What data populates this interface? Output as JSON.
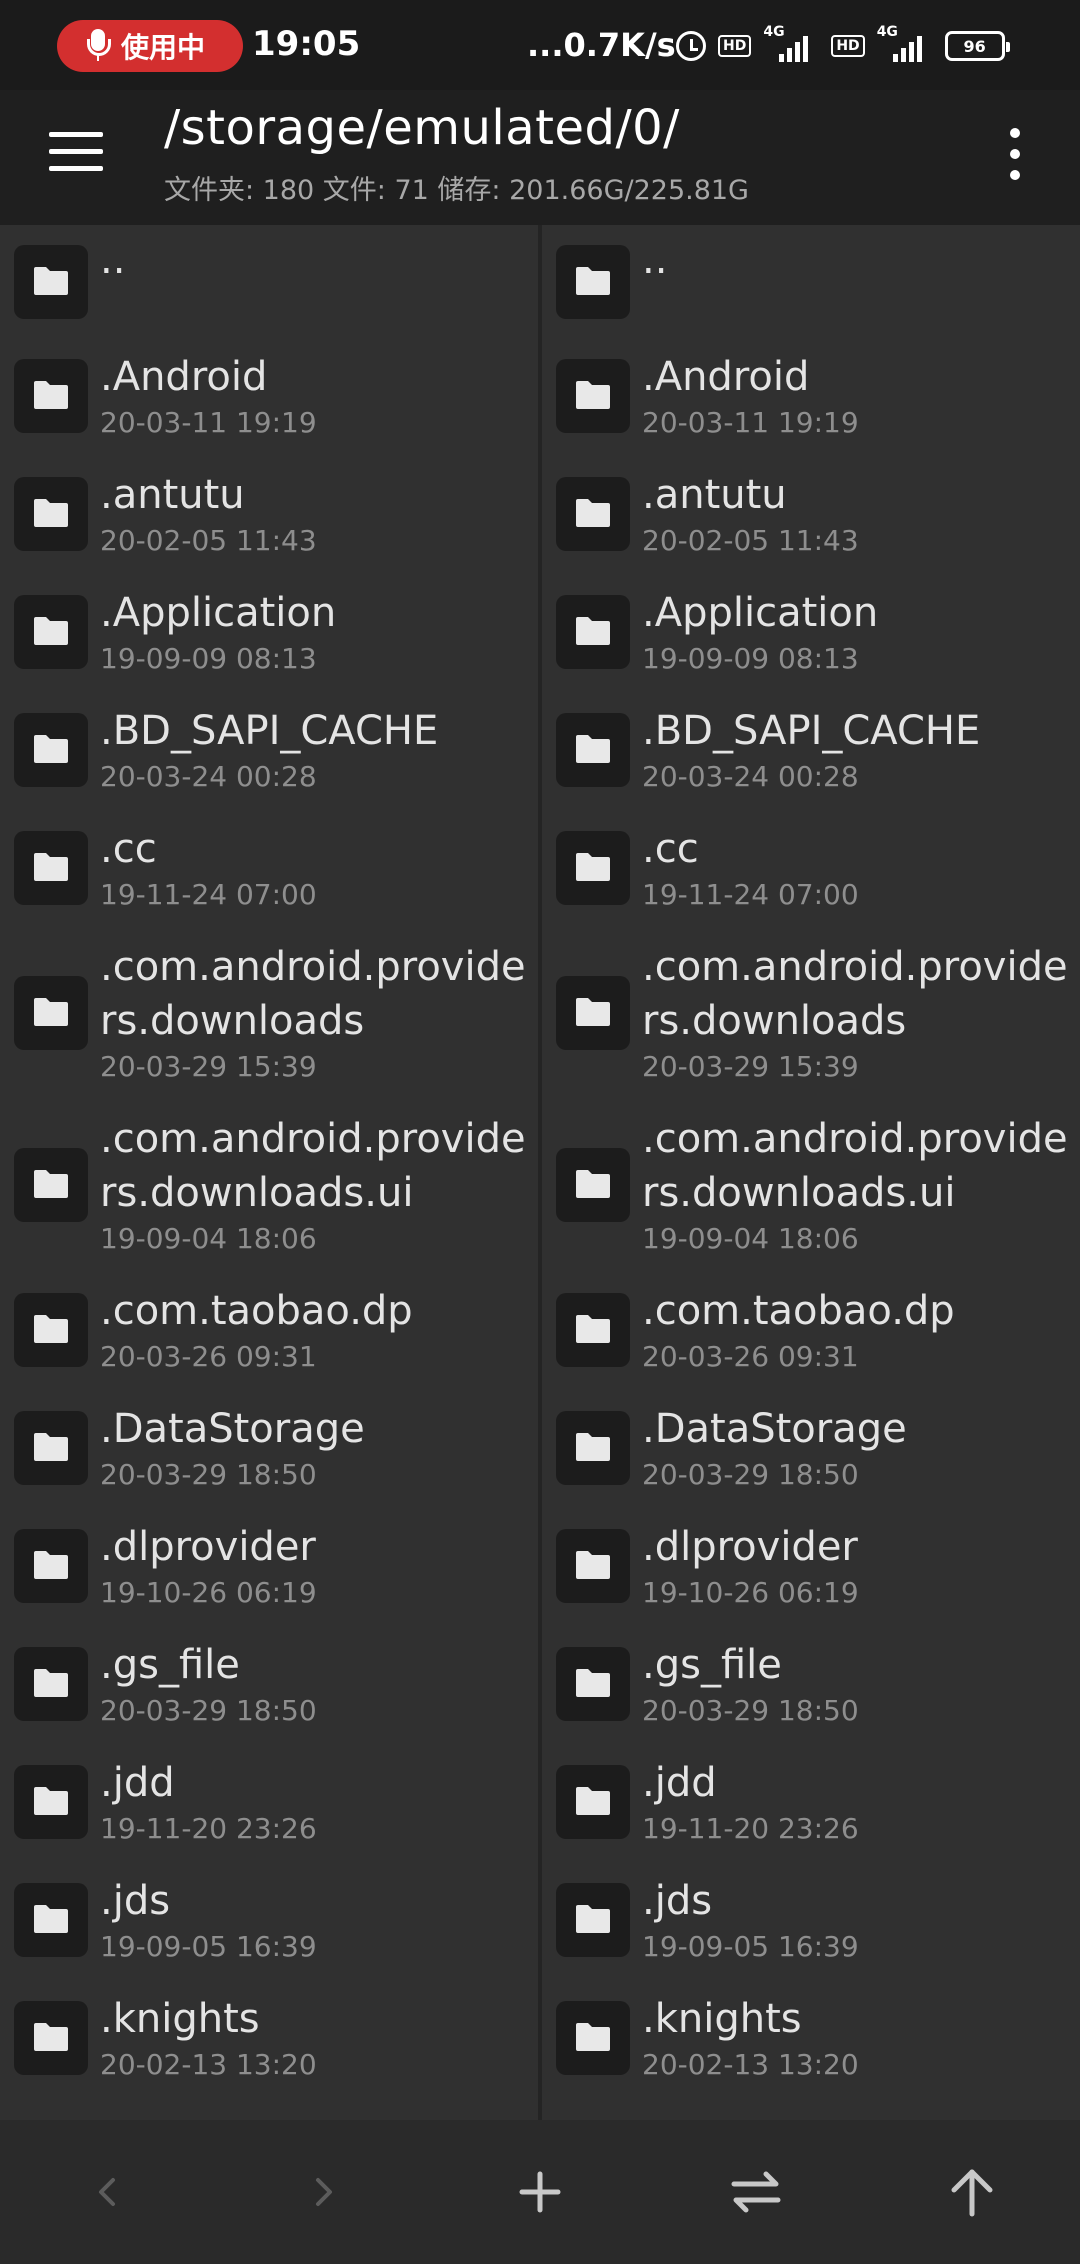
{
  "status_bar": {
    "mic_label": "使用中",
    "time": "19:05",
    "net_speed": "...0.7K/s",
    "hd1": "HD",
    "net1": "4G",
    "hd2": "HD",
    "net2": "4G",
    "battery": "96"
  },
  "toolbar": {
    "path": "/storage/emulated/0/",
    "summary": "文件夹: 180   文件: 71   储存: 201.66G/225.81G"
  },
  "left_pane": {
    "items": [
      {
        "name": "..",
        "date": ""
      },
      {
        "name": ".Android",
        "date": "20-03-11 19:19"
      },
      {
        "name": ".antutu",
        "date": "20-02-05 11:43"
      },
      {
        "name": ".Application",
        "date": "19-09-09 08:13"
      },
      {
        "name": ".BD_SAPI_CACHE",
        "date": "20-03-24 00:28"
      },
      {
        "name": ".cc",
        "date": "19-11-24 07:00"
      },
      {
        "name": ".com.android.providers.downloads",
        "date": "20-03-29 15:39"
      },
      {
        "name": ".com.android.providers.downloads.ui",
        "date": "19-09-04 18:06"
      },
      {
        "name": ".com.taobao.dp",
        "date": "20-03-26 09:31"
      },
      {
        "name": ".DataStorage",
        "date": "20-03-29 18:50"
      },
      {
        "name": ".dlprovider",
        "date": "19-10-26 06:19"
      },
      {
        "name": ".gs_file",
        "date": "20-03-29 18:50"
      },
      {
        "name": ".jdd",
        "date": "19-11-20 23:26"
      },
      {
        "name": ".jds",
        "date": "19-09-05 16:39"
      },
      {
        "name": ".knights",
        "date": "20-02-13 13:20"
      }
    ]
  },
  "right_pane": {
    "items": [
      {
        "name": "..",
        "date": ""
      },
      {
        "name": ".Android",
        "date": "20-03-11 19:19"
      },
      {
        "name": ".antutu",
        "date": "20-02-05 11:43"
      },
      {
        "name": ".Application",
        "date": "19-09-09 08:13"
      },
      {
        "name": ".BD_SAPI_CACHE",
        "date": "20-03-24 00:28"
      },
      {
        "name": ".cc",
        "date": "19-11-24 07:00"
      },
      {
        "name": ".com.android.providers.downloads",
        "date": "20-03-29 15:39"
      },
      {
        "name": ".com.android.providers.downloads.ui",
        "date": "19-09-04 18:06"
      },
      {
        "name": ".com.taobao.dp",
        "date": "20-03-26 09:31"
      },
      {
        "name": ".DataStorage",
        "date": "20-03-29 18:50"
      },
      {
        "name": ".dlprovider",
        "date": "19-10-26 06:19"
      },
      {
        "name": ".gs_file",
        "date": "20-03-29 18:50"
      },
      {
        "name": ".jdd",
        "date": "19-11-20 23:26"
      },
      {
        "name": ".jds",
        "date": "19-09-05 16:39"
      },
      {
        "name": ".knights",
        "date": "20-02-13 13:20"
      }
    ]
  },
  "bottom_nav": {
    "icons": [
      "chevron-left-icon",
      "chevron-right-icon",
      "plus-icon",
      "swap-icon",
      "arrow-up-icon"
    ]
  },
  "colors": {
    "background": "#2f2f2f",
    "toolbar": "#1f1f1f",
    "mic_pill": "#d32f2f",
    "folder_tile": "#1c1c1c"
  }
}
